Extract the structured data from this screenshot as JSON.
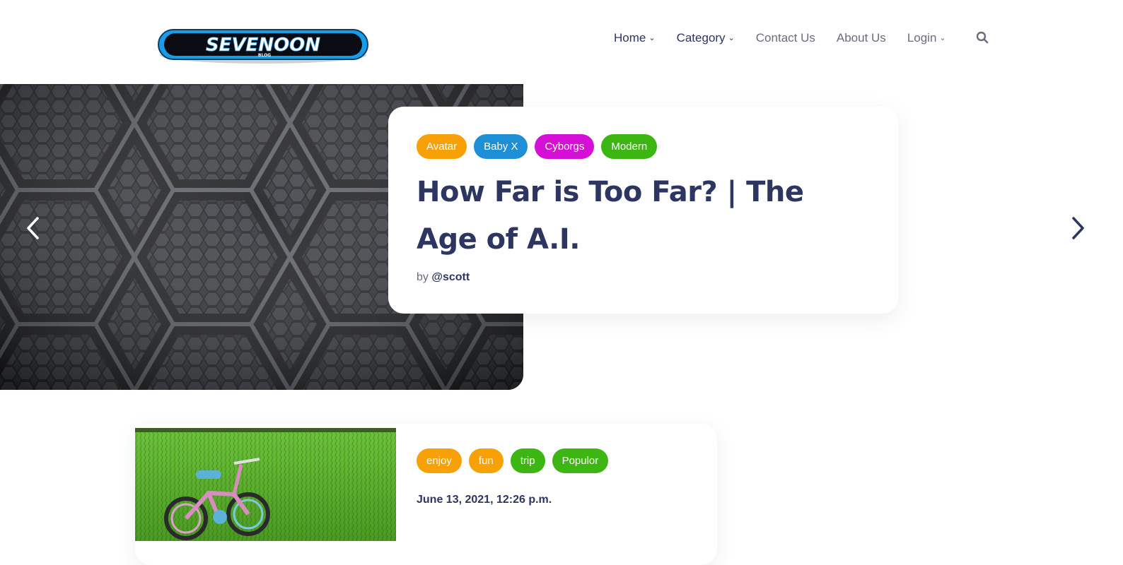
{
  "header": {
    "logo_text": "SEVENOON",
    "logo_subtext": "BLOG",
    "nav": [
      {
        "label": "Home",
        "has_dropdown": true
      },
      {
        "label": "Category",
        "has_dropdown": true
      },
      {
        "label": "Contact Us",
        "has_dropdown": false
      },
      {
        "label": "About Us",
        "has_dropdown": false
      },
      {
        "label": "Login",
        "has_dropdown": true
      }
    ],
    "search_icon": "search-icon"
  },
  "hero": {
    "tags": [
      {
        "label": "Avatar",
        "color": "#f8a107"
      },
      {
        "label": "Baby X",
        "color": "#1e8fd6"
      },
      {
        "label": "Cyborgs",
        "color": "#d60fd6"
      },
      {
        "label": "Modern",
        "color": "#3db513"
      }
    ],
    "title": "How Far is Too Far? | The Age of A.I.",
    "by_label": "by",
    "author": "@scott",
    "prev_icon": "chevron-left-icon",
    "next_icon": "chevron-right-icon"
  },
  "post": {
    "tags": [
      {
        "label": "enjoy",
        "color": "#f8a107"
      },
      {
        "label": "fun",
        "color": "#f8a107"
      },
      {
        "label": "trip",
        "color": "#3db513"
      },
      {
        "label": "Populor",
        "color": "#3db513"
      }
    ],
    "date": "June 13, 2021, 12:26 p.m."
  },
  "colors": {
    "heading": "#2d3561",
    "muted": "#6b6b7b"
  }
}
